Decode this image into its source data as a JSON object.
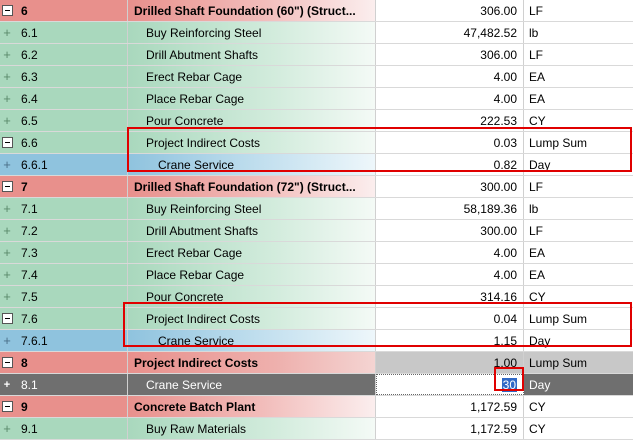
{
  "rows": [
    {
      "type": "hdr",
      "num": "6",
      "desc": "Drilled Shaft Foundation (60\") (Struct...",
      "qty": "306.00",
      "unit": "LF"
    },
    {
      "type": "sub",
      "num": "6.1",
      "desc": "Buy Reinforcing Steel",
      "qty": "47,482.52",
      "unit": "lb"
    },
    {
      "type": "sub",
      "num": "6.2",
      "desc": "Drill Abutment Shafts",
      "qty": "306.00",
      "unit": "LF"
    },
    {
      "type": "sub",
      "num": "6.3",
      "desc": "Erect Rebar Cage",
      "qty": "4.00",
      "unit": "EA"
    },
    {
      "type": "sub",
      "num": "6.4",
      "desc": "Place Rebar Cage",
      "qty": "4.00",
      "unit": "EA"
    },
    {
      "type": "sub",
      "num": "6.5",
      "desc": "Pour Concrete",
      "qty": "222.53",
      "unit": "CY"
    },
    {
      "type": "sub",
      "num": "6.6",
      "desc": "Project Indirect Costs",
      "qty": "0.03",
      "unit": "Lump Sum"
    },
    {
      "type": "sub2",
      "num": "6.6.1",
      "desc": "Crane Service",
      "qty": "0.82",
      "unit": "Day"
    },
    {
      "type": "hdr",
      "num": "7",
      "desc": "Drilled Shaft Foundation (72\") (Struct...",
      "qty": "300.00",
      "unit": "LF"
    },
    {
      "type": "sub",
      "num": "7.1",
      "desc": "Buy Reinforcing Steel",
      "qty": "58,189.36",
      "unit": "lb"
    },
    {
      "type": "sub",
      "num": "7.2",
      "desc": "Drill Abutment Shafts",
      "qty": "300.00",
      "unit": "LF"
    },
    {
      "type": "sub",
      "num": "7.3",
      "desc": "Erect Rebar Cage",
      "qty": "4.00",
      "unit": "EA"
    },
    {
      "type": "sub",
      "num": "7.4",
      "desc": "Place Rebar Cage",
      "qty": "4.00",
      "unit": "EA"
    },
    {
      "type": "sub",
      "num": "7.5",
      "desc": "Pour Concrete",
      "qty": "314.16",
      "unit": "CY"
    },
    {
      "type": "sub",
      "num": "7.6",
      "desc": "Project Indirect Costs",
      "qty": "0.04",
      "unit": "Lump Sum"
    },
    {
      "type": "sub2",
      "num": "7.6.1",
      "desc": "Crane Service",
      "qty": "1.15",
      "unit": "Day"
    },
    {
      "type": "grey",
      "num": "8",
      "desc": "Project Indirect Costs",
      "qty": "1.00",
      "unit": "Lump Sum"
    },
    {
      "type": "sel",
      "num": "8.1",
      "desc": "Crane Service",
      "qty": "30",
      "unit": "Day"
    },
    {
      "type": "hdr",
      "num": "9",
      "desc": "Concrete Batch Plant",
      "qty": "1,172.59",
      "unit": "CY"
    },
    {
      "type": "sub",
      "num": "9.1",
      "desc": "Buy Raw Materials",
      "qty": "1,172.59",
      "unit": "CY"
    }
  ],
  "colors": {
    "highlight": "#e00000",
    "header": "#e8908c",
    "subitem": "#a9d8bd",
    "subsub": "#8fc3de",
    "selected": "#6f6f6f"
  }
}
